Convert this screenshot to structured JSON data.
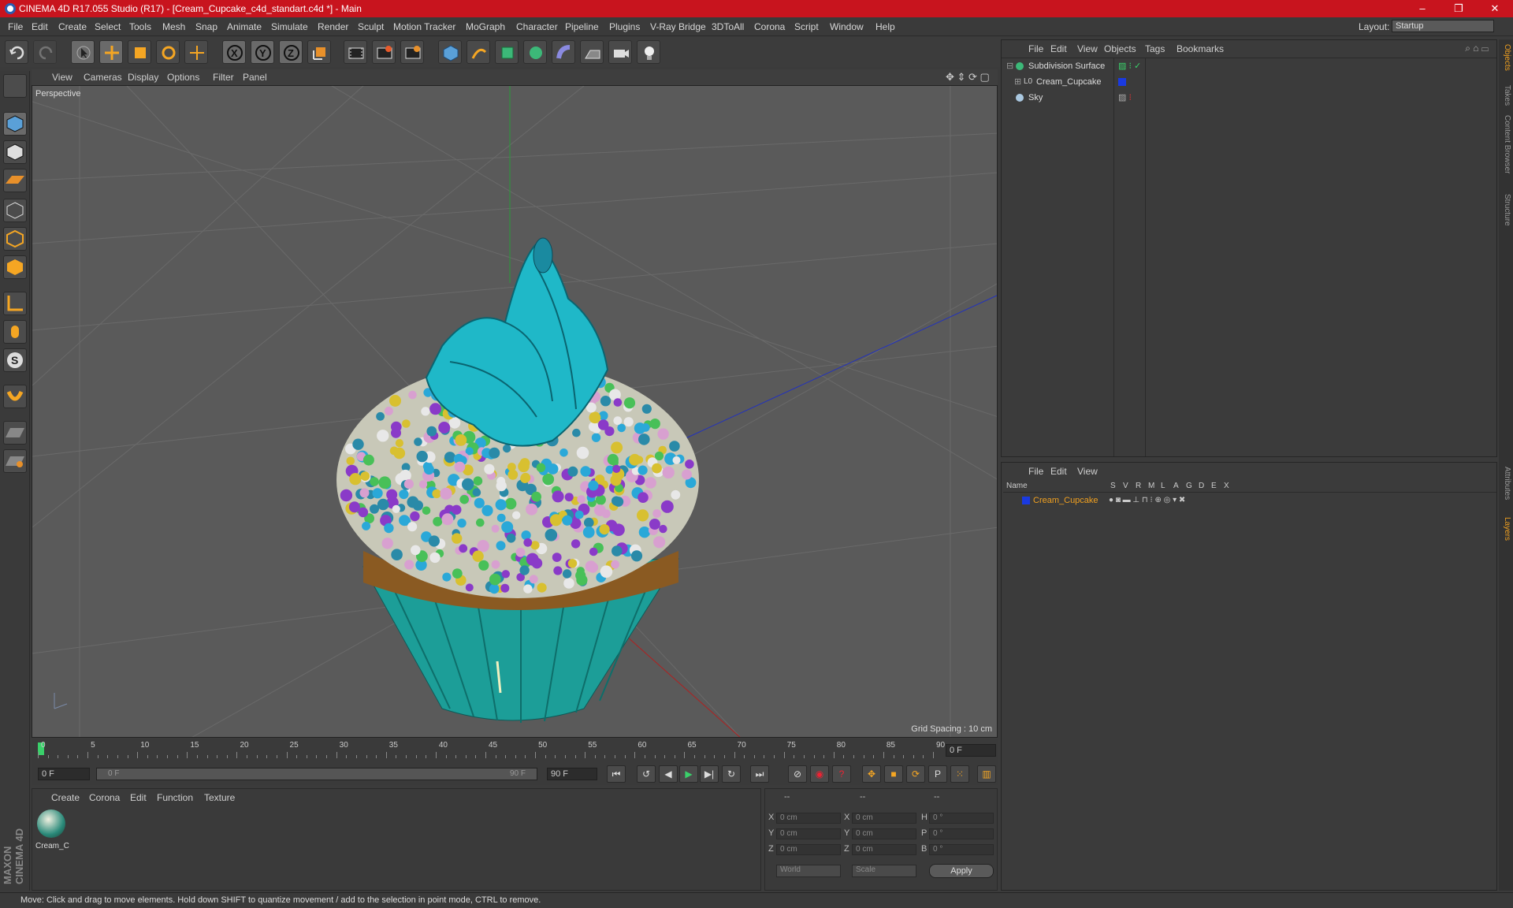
{
  "titlebar": {
    "title": "CINEMA 4D R17.055 Studio (R17) - [Cream_Cupcake_c4d_standart.c4d *] - Main"
  },
  "menubar": {
    "items": [
      "File",
      "Edit",
      "Create",
      "Select",
      "Tools",
      "Mesh",
      "Snap",
      "Animate",
      "Simulate",
      "Render",
      "Sculpt",
      "Motion Tracker",
      "MoGraph",
      "Character",
      "Pipeline",
      "Plugins",
      "V-Ray Bridge",
      "3DToAll",
      "Corona",
      "Script",
      "Window",
      "Help"
    ],
    "layout_label": "Layout:",
    "layout_value": "Startup"
  },
  "viewport": {
    "menu": [
      "View",
      "Cameras",
      "Display",
      "Options",
      "Filter",
      "Panel"
    ],
    "label": "Perspective",
    "grid_spacing": "Grid Spacing : 10 cm"
  },
  "timeline": {
    "ticks": [
      "0",
      "5",
      "10",
      "15",
      "20",
      "25",
      "30",
      "35",
      "40",
      "45",
      "50",
      "55",
      "60",
      "65",
      "70",
      "75",
      "80",
      "85",
      "90"
    ],
    "current_frame": "0 F",
    "start_frame": "0 F",
    "range_start": "0 F",
    "range_end": "90 F",
    "end_frame": "90 F"
  },
  "material_manager": {
    "menu": [
      "Create",
      "Corona",
      "Edit",
      "Function",
      "Texture"
    ],
    "material_name": "Cream_C"
  },
  "coordinates": {
    "header": [
      "--",
      "--",
      "--"
    ],
    "rows": [
      {
        "a": "X",
        "av": "0 cm",
        "b": "X",
        "bv": "0 cm",
        "c": "H",
        "cv": "0 °"
      },
      {
        "a": "Y",
        "av": "0 cm",
        "b": "Y",
        "bv": "0 cm",
        "c": "P",
        "cv": "0 °"
      },
      {
        "a": "Z",
        "av": "0 cm",
        "b": "Z",
        "bv": "0 cm",
        "c": "B",
        "cv": "0 °"
      }
    ],
    "world": "World",
    "scale": "Scale",
    "apply": "Apply"
  },
  "object_manager": {
    "menu": [
      "File",
      "Edit",
      "View",
      "Objects",
      "Tags",
      "Bookmarks"
    ],
    "objects": [
      "Subdivision Surface",
      "Cream_Cupcake",
      "Sky"
    ]
  },
  "layer_manager": {
    "menu": [
      "File",
      "Edit",
      "View"
    ],
    "columns": [
      "Name",
      "S",
      "V",
      "R",
      "M",
      "L",
      "A",
      "G",
      "D",
      "E",
      "X"
    ],
    "layer": "Cream_Cupcake"
  },
  "right_tabs": [
    "Objects",
    "Takes",
    "Content Browser",
    "Structure",
    "Attributes",
    "Layers"
  ],
  "status": "Move: Click and drag to move elements. Hold down SHIFT to quantize movement / add to the selection in point mode, CTRL to remove.",
  "brand": "MAXON CINEMA 4D",
  "colors": {
    "accent": "#c8141e",
    "cyan_frosting": "#1fb8c8",
    "object_label": "#f0a020"
  }
}
